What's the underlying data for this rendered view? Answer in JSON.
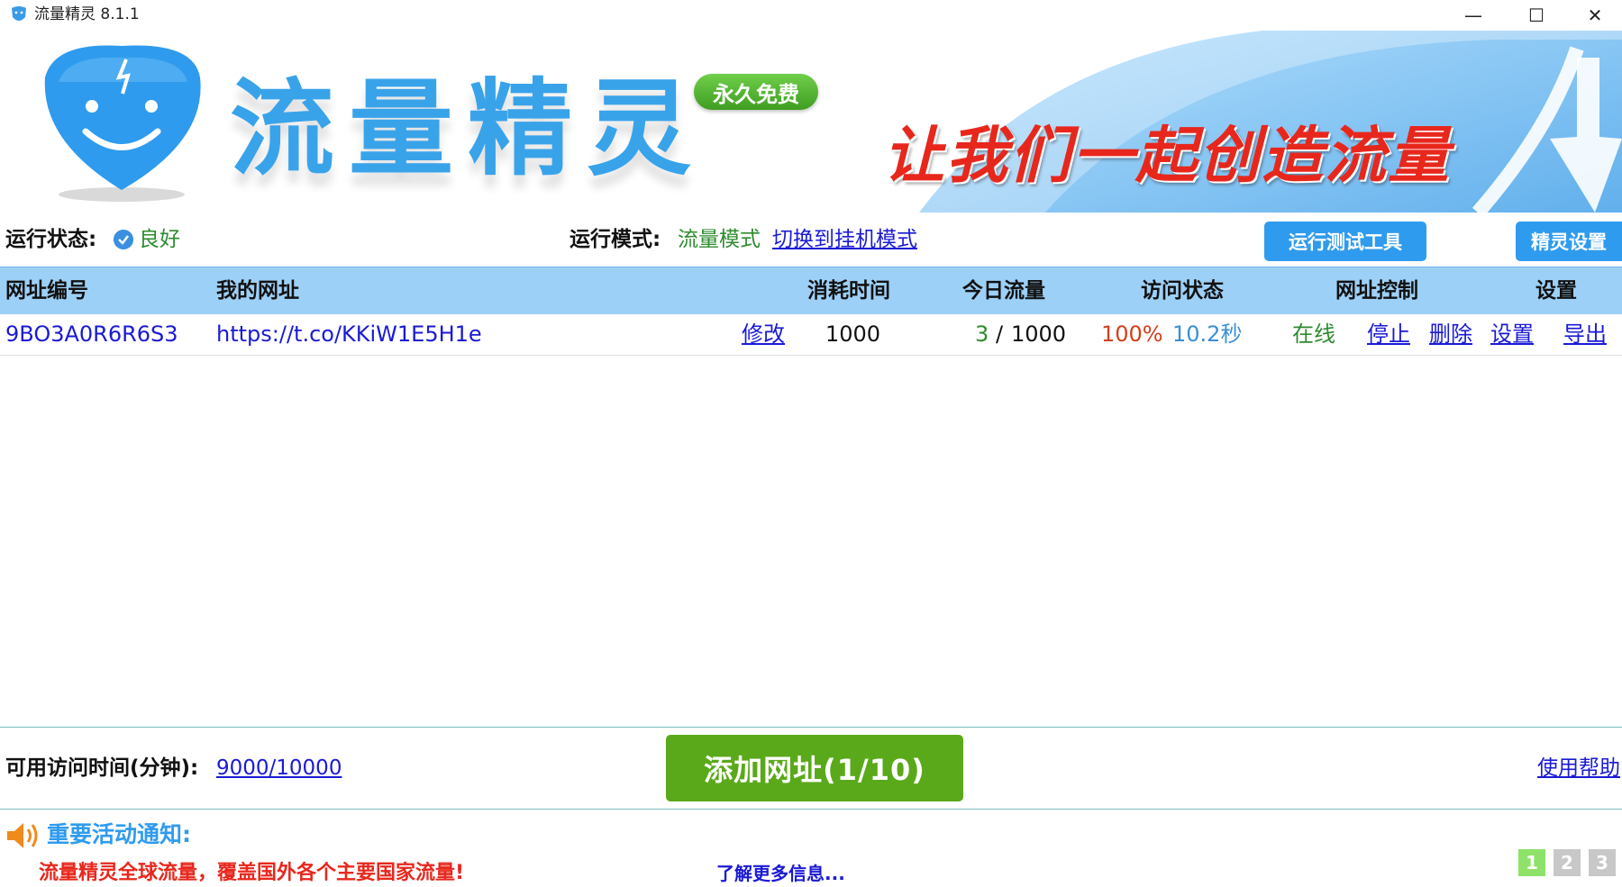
{
  "window": {
    "title": "流量精灵 8.1.1",
    "minimize_glyph": "—",
    "maximize_glyph": "☐",
    "close_glyph": "✕"
  },
  "banner": {
    "brand": "流量精灵",
    "badge": "永久免费",
    "slogan": "让我们一起创造流量"
  },
  "status": {
    "run_state_label": "运行状态:",
    "run_state_value": "良好",
    "mode_label": "运行模式:",
    "mode_value": "流量模式",
    "switch_link": "切换到挂机模式",
    "test_tool_button": "运行测试工具",
    "settings_button": "精灵设置"
  },
  "table": {
    "headers": {
      "id": "网址编号",
      "url": "我的网址",
      "time": "消耗时间",
      "today": "今日流量",
      "visit": "访问状态",
      "control": "网址控制",
      "settings": "设置"
    },
    "rows": [
      {
        "id": "9BO3A0R6R6S3",
        "url": "https://t.co/KKiW1E5H1e",
        "edit": "修改",
        "time": "1000",
        "today_count": "3",
        "today_sep": "/",
        "today_total": "1000",
        "visit_pct": "100%",
        "visit_sec": "10.2秒",
        "online": "在线",
        "stop": "停止",
        "delete": "删除",
        "setup": "设置",
        "export": "导出"
      }
    ]
  },
  "bottom": {
    "time_label": "可用访问时间(分钟):",
    "time_value": "9000/10000",
    "add_button": "添加网址(1/10)",
    "help_link": "使用帮助"
  },
  "notice": {
    "title": "重要活动通知:",
    "message": "流量精灵全球流量，覆盖国外各个主要国家流量!",
    "more_link": "了解更多信息...",
    "pages": [
      "1",
      "2",
      "3"
    ]
  },
  "colors": {
    "accent_blue": "#2f9bee",
    "header_blue": "#9dd0f7",
    "add_green": "#5aa91a",
    "link_blue": "#1a1ad6",
    "ok_green": "#2e8b2e",
    "alert_red": "#e8271c"
  },
  "icons": [
    "app-logo-icon",
    "mascot-icon",
    "check-icon",
    "speaker-icon",
    "arrow-graphic-icon"
  ]
}
